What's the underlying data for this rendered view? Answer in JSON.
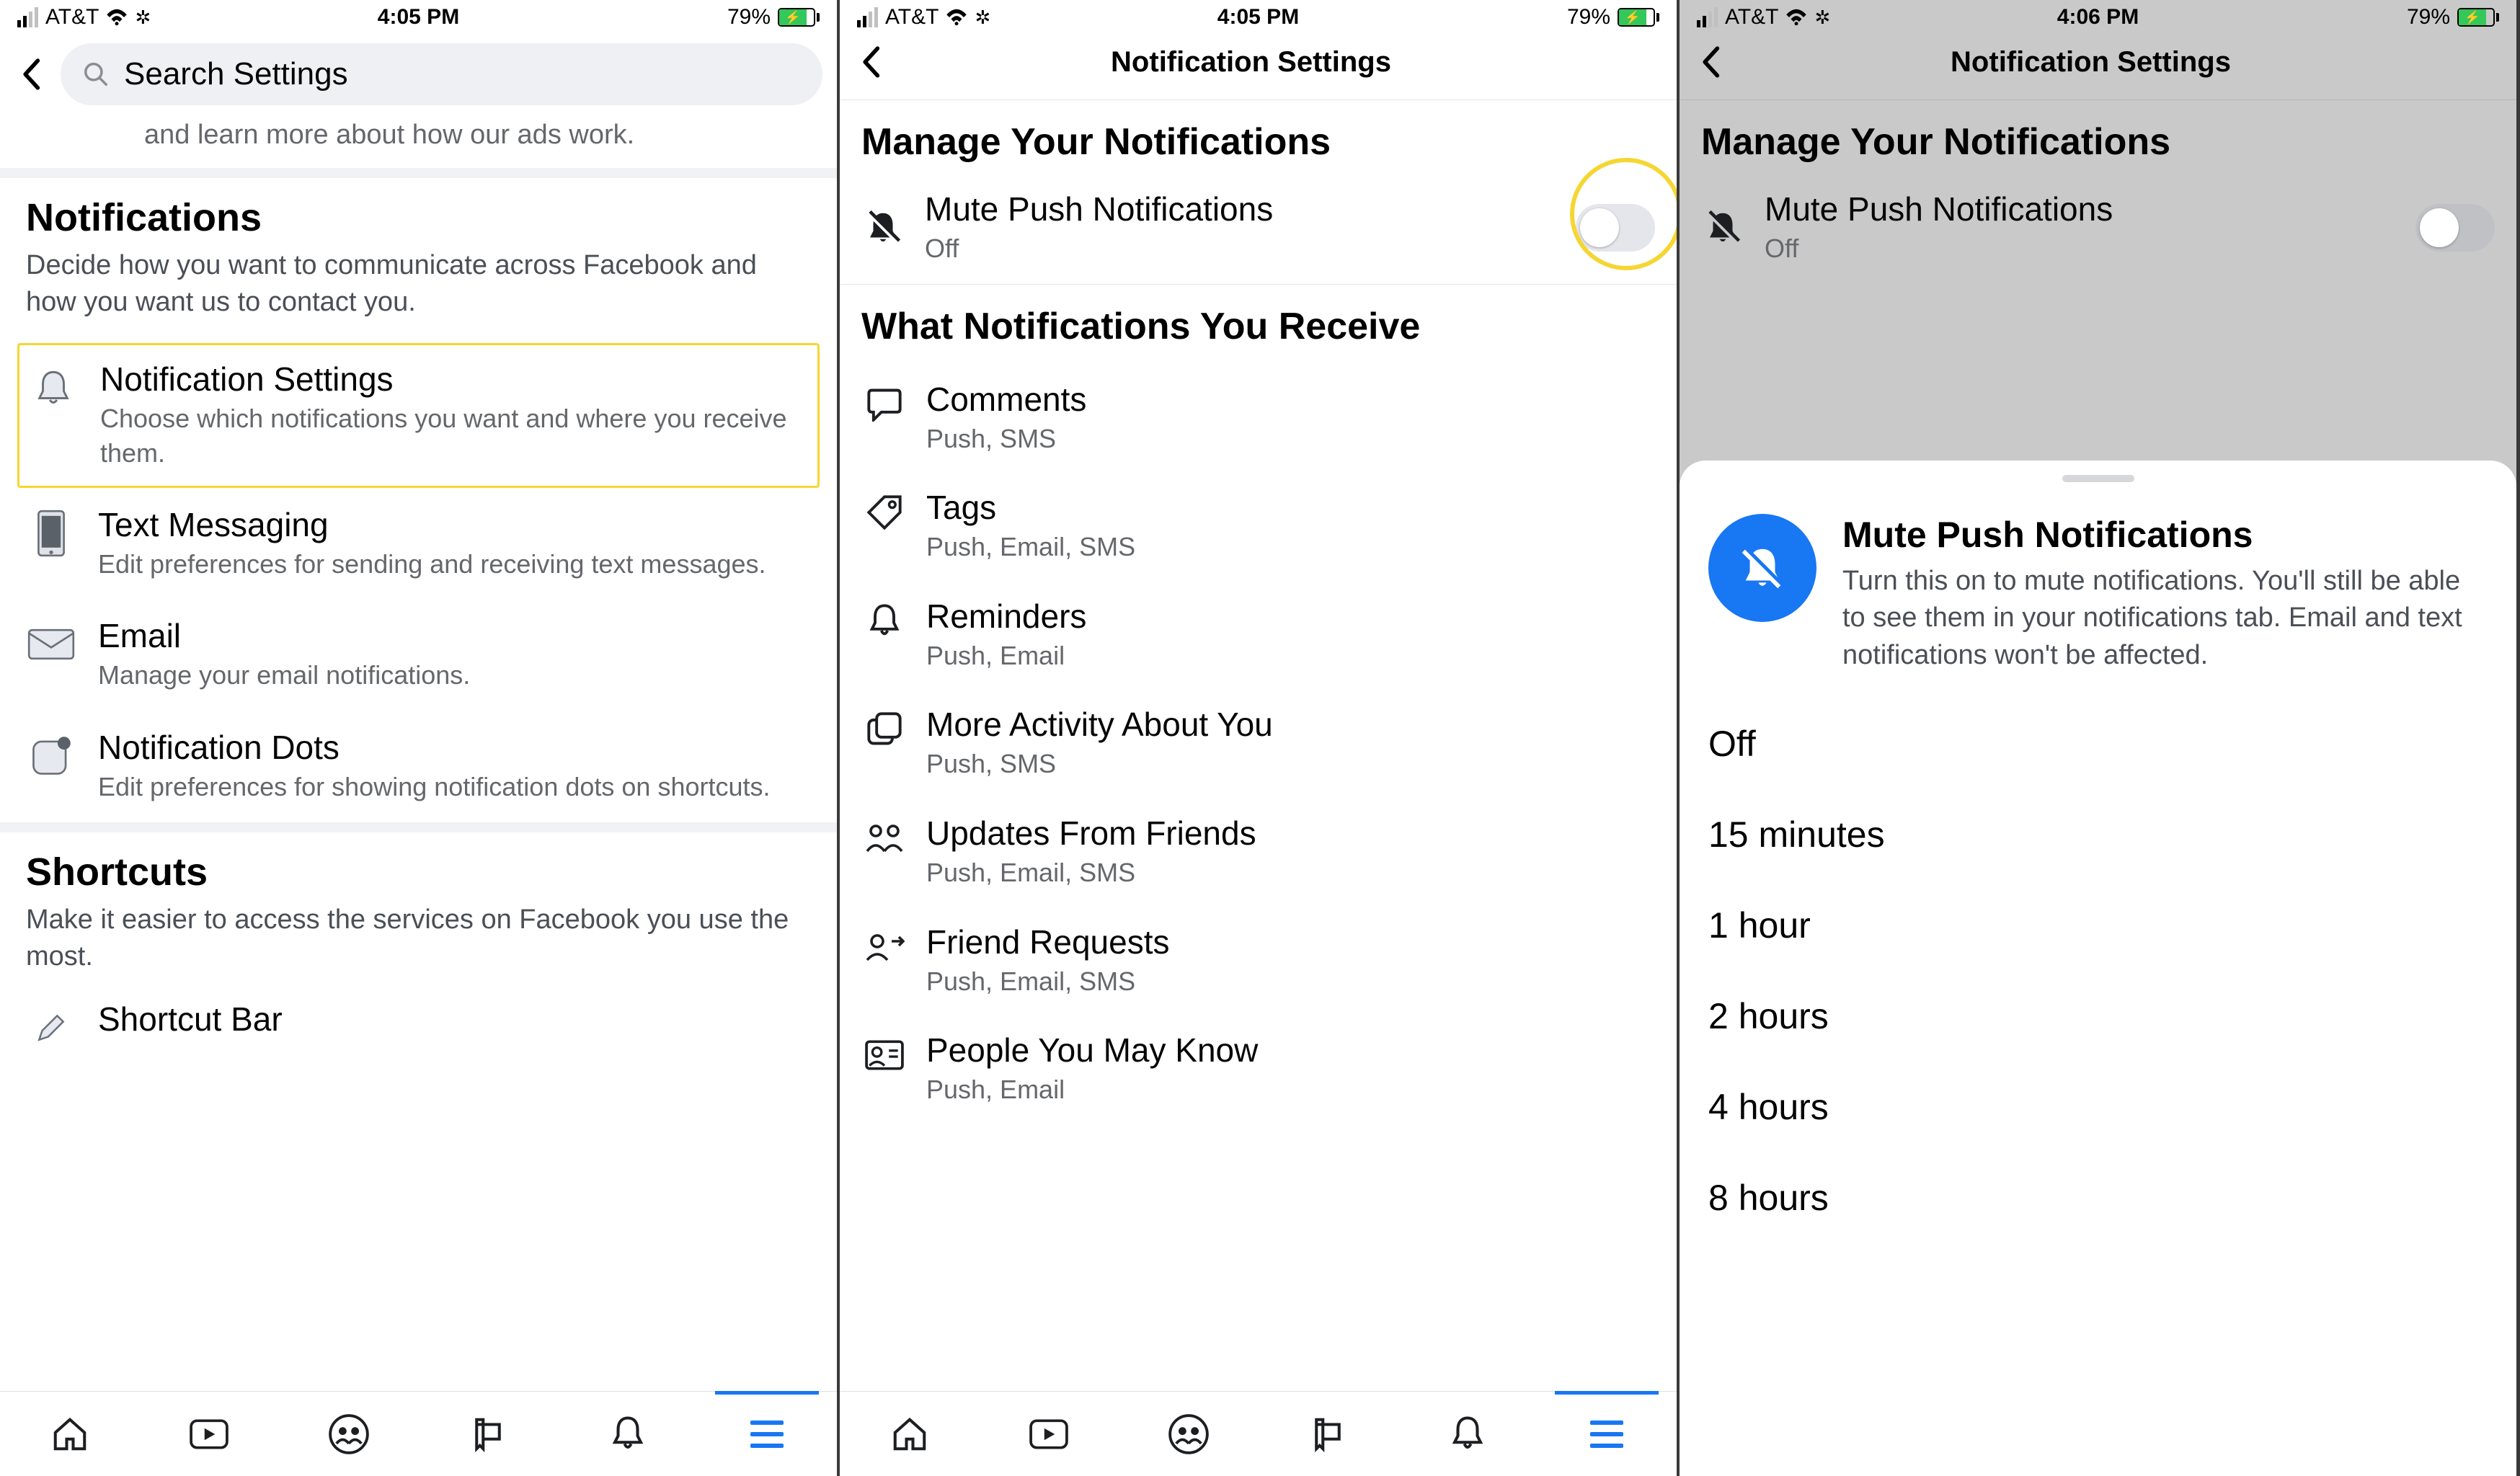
{
  "status": {
    "carrier": "AT&T",
    "time1": "4:05 PM",
    "time2": "4:05 PM",
    "time3": "4:06 PM",
    "battery_pct": "79%"
  },
  "screen1": {
    "search_placeholder": "Search Settings",
    "truncated_text": "and learn more about how our ads work.",
    "notifications": {
      "heading": "Notifications",
      "desc": "Decide how you want to communicate across Facebook and how you want us to contact you."
    },
    "items": [
      {
        "title": "Notification Settings",
        "sub": "Choose which notifications you want and where you receive them."
      },
      {
        "title": "Text Messaging",
        "sub": "Edit preferences for sending and receiving text messages."
      },
      {
        "title": "Email",
        "sub": "Manage your email notifications."
      },
      {
        "title": "Notification Dots",
        "sub": "Edit preferences for showing notification dots on shortcuts."
      }
    ],
    "shortcuts": {
      "heading": "Shortcuts",
      "desc": "Make it easier to access the services on Facebook you use the most.",
      "item0": "Shortcut Bar"
    }
  },
  "screen2": {
    "title": "Notification Settings",
    "manage_heading": "Manage Your Notifications",
    "mute": {
      "title": "Mute Push Notifications",
      "state": "Off"
    },
    "receive_heading": "What Notifications You Receive",
    "items": [
      {
        "title": "Comments",
        "sub": "Push, SMS"
      },
      {
        "title": "Tags",
        "sub": "Push, Email, SMS"
      },
      {
        "title": "Reminders",
        "sub": "Push, Email"
      },
      {
        "title": "More Activity About You",
        "sub": "Push, SMS"
      },
      {
        "title": "Updates From Friends",
        "sub": "Push, Email, SMS"
      },
      {
        "title": "Friend Requests",
        "sub": "Push, Email, SMS"
      },
      {
        "title": "People You May Know",
        "sub": "Push, Email"
      }
    ]
  },
  "screen3": {
    "title": "Notification Settings",
    "manage_heading": "Manage Your Notifications",
    "mute": {
      "title": "Mute Push Notifications",
      "state": "Off"
    },
    "sheet": {
      "title": "Mute Push Notifications",
      "desc": "Turn this on to mute notifications. You'll still be able to see them in your notifications tab. Email and text notifications won't be affected.",
      "options": [
        "Off",
        "15 minutes",
        "1 hour",
        "2 hours",
        "4 hours",
        "8 hours"
      ]
    }
  }
}
